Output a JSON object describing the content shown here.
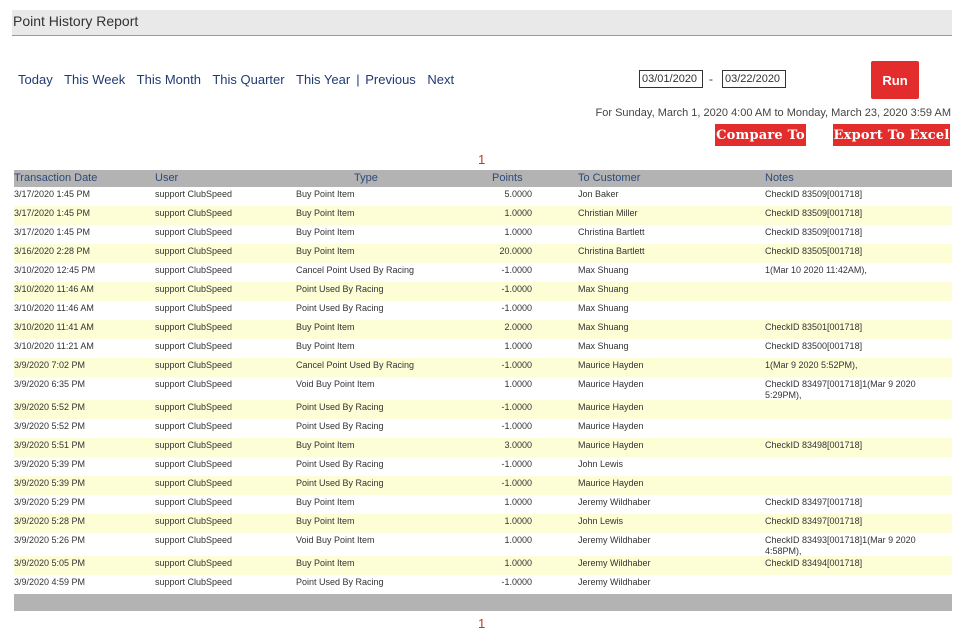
{
  "report": {
    "title": "Point History Report"
  },
  "ranges": {
    "today": "Today",
    "this_week": "This Week",
    "this_month": "This Month",
    "this_quarter": "This Quarter",
    "this_year": "This Year",
    "separator": "|",
    "previous": "Previous",
    "next": "Next"
  },
  "dates": {
    "start": "03/01/2020",
    "dash": "-",
    "end": "03/22/2020"
  },
  "buttons": {
    "run": "Run",
    "compare": "Compare To",
    "export": "Export To Excel"
  },
  "period_text": "For Sunday, March 1, 2020 4:00 AM to Monday, March 23, 2020 3:59 AM",
  "pager": {
    "top": "1",
    "bottom": "1"
  },
  "table": {
    "columns": [
      "Transaction Date",
      "User",
      "Type",
      "Points",
      "To Customer",
      "Notes"
    ],
    "rows": [
      [
        "3/17/2020 1:45 PM",
        "support ClubSpeed",
        "Buy Point Item",
        "5.0000",
        "Jon Baker",
        "CheckID 83509[001718]"
      ],
      [
        "3/17/2020 1:45 PM",
        "support ClubSpeed",
        "Buy Point Item",
        "1.0000",
        "Christian Miller",
        "CheckID 83509[001718]"
      ],
      [
        "3/17/2020 1:45 PM",
        "support ClubSpeed",
        "Buy Point Item",
        "1.0000",
        "Christina Bartlett",
        "CheckID 83509[001718]"
      ],
      [
        "3/16/2020 2:28 PM",
        "support ClubSpeed",
        "Buy Point Item",
        "20.0000",
        "Christina Bartlett",
        "CheckID 83505[001718]"
      ],
      [
        "3/10/2020 12:45 PM",
        "support ClubSpeed",
        "Cancel Point Used By Racing",
        "-1.0000",
        "Max Shuang",
        "1(Mar 10 2020 11:42AM),"
      ],
      [
        "3/10/2020 11:46 AM",
        "support ClubSpeed",
        "Point Used By Racing",
        "-1.0000",
        "Max Shuang",
        ""
      ],
      [
        "3/10/2020 11:46 AM",
        "support ClubSpeed",
        "Point Used By Racing",
        "-1.0000",
        "Max Shuang",
        ""
      ],
      [
        "3/10/2020 11:41 AM",
        "support ClubSpeed",
        "Buy Point Item",
        "2.0000",
        "Max Shuang",
        "CheckID 83501[001718]"
      ],
      [
        "3/10/2020 11:21 AM",
        "support ClubSpeed",
        "Buy Point Item",
        "1.0000",
        "Max Shuang",
        "CheckID 83500[001718]"
      ],
      [
        "3/9/2020 7:02 PM",
        "support ClubSpeed",
        "Cancel Point Used By Racing",
        "-1.0000",
        "Maurice Hayden",
        "1(Mar 9 2020 5:52PM),"
      ],
      [
        "3/9/2020 6:35 PM",
        "support ClubSpeed",
        "Void Buy Point Item",
        "1.0000",
        "Maurice Hayden",
        "CheckID 83497[001718]1(Mar 9 2020 5:29PM),"
      ],
      [
        "3/9/2020 5:52 PM",
        "support ClubSpeed",
        "Point Used By Racing",
        "-1.0000",
        "Maurice Hayden",
        ""
      ],
      [
        "3/9/2020 5:52 PM",
        "support ClubSpeed",
        "Point Used By Racing",
        "-1.0000",
        "Maurice Hayden",
        ""
      ],
      [
        "3/9/2020 5:51 PM",
        "support ClubSpeed",
        "Buy Point Item",
        "3.0000",
        "Maurice Hayden",
        "CheckID 83498[001718]"
      ],
      [
        "3/9/2020 5:39 PM",
        "support ClubSpeed",
        "Point Used By Racing",
        "-1.0000",
        "John Lewis",
        ""
      ],
      [
        "3/9/2020 5:39 PM",
        "support ClubSpeed",
        "Point Used By Racing",
        "-1.0000",
        "Maurice Hayden",
        ""
      ],
      [
        "3/9/2020 5:29 PM",
        "support ClubSpeed",
        "Buy Point Item",
        "1.0000",
        "Jeremy Wildhaber",
        "CheckID 83497[001718]"
      ],
      [
        "3/9/2020 5:28 PM",
        "support ClubSpeed",
        "Buy Point Item",
        "1.0000",
        "John Lewis",
        "CheckID 83497[001718]"
      ],
      [
        "3/9/2020 5:26 PM",
        "support ClubSpeed",
        "Void Buy Point Item",
        "1.0000",
        "Jeremy Wildhaber",
        "CheckID 83493[001718]1(Mar 9 2020 4:58PM),"
      ],
      [
        "3/9/2020 5:05 PM",
        "support ClubSpeed",
        "Buy Point Item",
        "1.0000",
        "Jeremy Wildhaber",
        "CheckID 83494[001718]"
      ],
      [
        "3/9/2020 4:59 PM",
        "support ClubSpeed",
        "Point Used By Racing",
        "-1.0000",
        "Jeremy Wildhaber",
        ""
      ]
    ]
  }
}
